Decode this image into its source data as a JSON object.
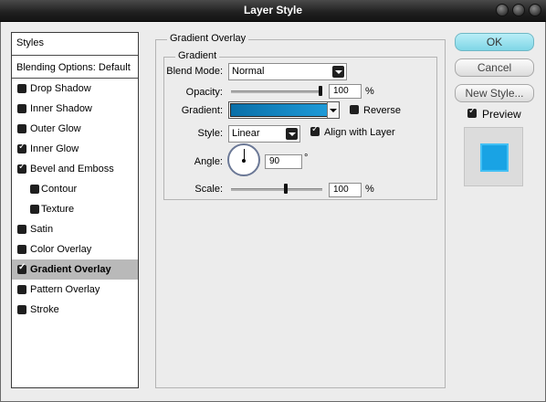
{
  "window": {
    "title": "Layer Style"
  },
  "styles_panel": {
    "header": "Styles",
    "blending_options": "Blending Options: Default",
    "items": [
      {
        "label": "Drop Shadow",
        "checked": false,
        "sub": false,
        "selected": false
      },
      {
        "label": "Inner Shadow",
        "checked": false,
        "sub": false,
        "selected": false
      },
      {
        "label": "Outer Glow",
        "checked": false,
        "sub": false,
        "selected": false
      },
      {
        "label": "Inner Glow",
        "checked": true,
        "sub": false,
        "selected": false
      },
      {
        "label": "Bevel and Emboss",
        "checked": true,
        "sub": false,
        "selected": false
      },
      {
        "label": "Contour",
        "checked": false,
        "sub": true,
        "selected": false
      },
      {
        "label": "Texture",
        "checked": false,
        "sub": true,
        "selected": false
      },
      {
        "label": "Satin",
        "checked": false,
        "sub": false,
        "selected": false
      },
      {
        "label": "Color Overlay",
        "checked": false,
        "sub": false,
        "selected": false
      },
      {
        "label": "Gradient Overlay",
        "checked": true,
        "sub": false,
        "selected": true
      },
      {
        "label": "Pattern Overlay",
        "checked": false,
        "sub": false,
        "selected": false
      },
      {
        "label": "Stroke",
        "checked": false,
        "sub": false,
        "selected": false
      }
    ]
  },
  "gradient_overlay": {
    "group_title": "Gradient Overlay",
    "subgroup_title": "Gradient",
    "blend_mode_label": "Blend Mode:",
    "blend_mode_value": "Normal",
    "opacity_label": "Opacity:",
    "opacity_value": "100",
    "opacity_fraction": 1.0,
    "percent_sign": "%",
    "gradient_label": "Gradient:",
    "gradient_colors": [
      "#0a6fa8",
      "#1e9ad8"
    ],
    "reverse_label": "Reverse",
    "reverse_checked": false,
    "style_label": "Style:",
    "style_value": "Linear",
    "align_label": "Align with Layer",
    "align_checked": true,
    "angle_label": "Angle:",
    "angle_value": "90",
    "degree_sign": "°",
    "scale_label": "Scale:",
    "scale_value": "100",
    "scale_fraction": 0.6
  },
  "buttons": {
    "ok": "OK",
    "cancel": "Cancel",
    "new_style": "New Style...",
    "preview_label": "Preview",
    "preview_checked": true
  },
  "colors": {
    "preview_swatch": "#19a3e4",
    "ok_button": "#9de3ef",
    "selected_row": "#b9b9b9"
  }
}
